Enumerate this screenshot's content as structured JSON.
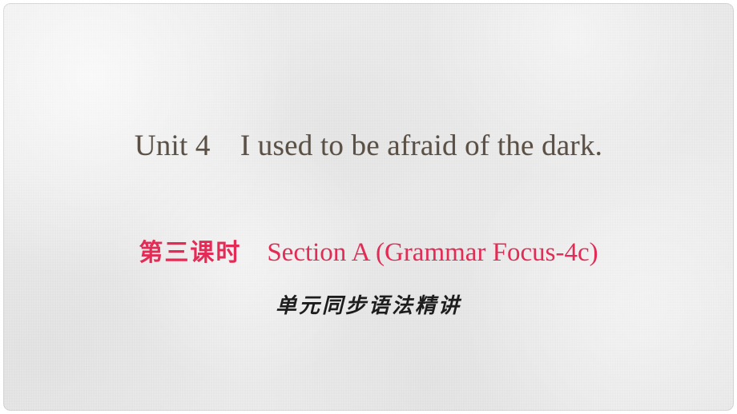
{
  "slide": {
    "background_color": "#e7e7e7",
    "page_background_color": "#ffffff",
    "unit_title": "Unit 4　I used to be afraid of the dark.",
    "unit_title_color": "#5a5046",
    "section": {
      "lesson_label": "第三课时",
      "separator": "　",
      "section_label": "Section A (Grammar Focus-4c)",
      "color": "#e32b55"
    },
    "subtitle": "单元同步语法精讲",
    "subtitle_color": "#1d1d1d"
  }
}
